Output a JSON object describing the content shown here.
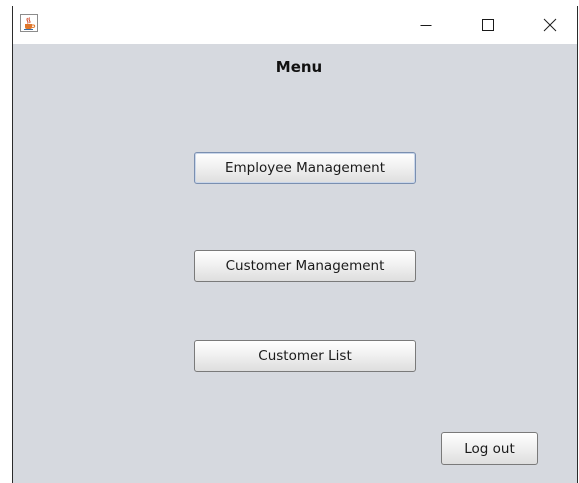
{
  "window": {
    "app_icon": "java-cup-icon",
    "controls": {
      "minimize": "minimize-icon",
      "maximize": "maximize-icon",
      "close": "close-icon"
    }
  },
  "menu": {
    "title": "Menu",
    "buttons": [
      {
        "label": "Employee Management",
        "focused": true
      },
      {
        "label": "Customer Management",
        "focused": false
      },
      {
        "label": "Customer List",
        "focused": false
      }
    ],
    "logout_label": "Log out"
  },
  "colors": {
    "background": "#d6d9df",
    "titlebar": "#ffffff",
    "focus_border": "#7a8fb0"
  }
}
